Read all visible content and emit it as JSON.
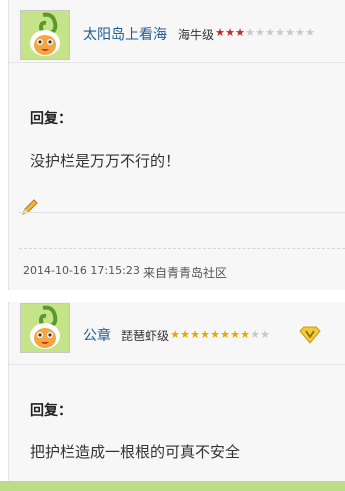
{
  "posts": [
    {
      "username": "太阳岛上看海",
      "rank": "海牛级",
      "stars_filled": 3,
      "stars_total": 10,
      "star_color": "red",
      "reply_label": "回复：",
      "content": "没护栏是万万不行的！",
      "timestamp": "2014-10-16 17:15:23",
      "source": "来自青青岛社区"
    },
    {
      "username": "公章",
      "rank": "琵琶虾级",
      "stars_filled": 8,
      "stars_total": 10,
      "star_color": "gold",
      "badge_icon": "vip-badge-icon",
      "reply_label": "回复：",
      "content": "把护栏造成一根根的可真不安全"
    }
  ],
  "colors": {
    "username": "#1f5b92",
    "star_red": "#c02a2a",
    "star_gold": "#e6a800",
    "star_empty": "#c9c9c9",
    "avatar_bg": "#bfe07a",
    "bottom_bar": "#bcdc86"
  }
}
